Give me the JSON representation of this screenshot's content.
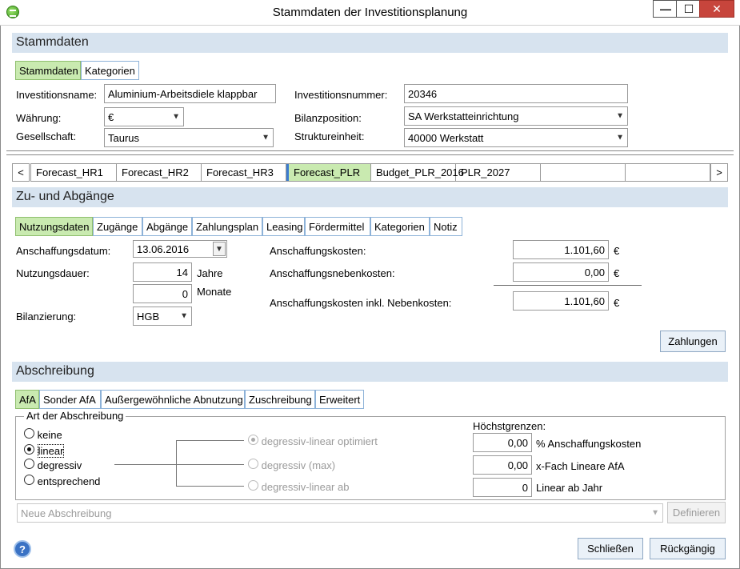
{
  "window": {
    "title": "Stammdaten der Investitionsplanung",
    "min_glyph": "—",
    "max_glyph": "☐",
    "close_glyph": "✕"
  },
  "stammdaten": {
    "header": "Stammdaten",
    "tabs": [
      "Stammdaten",
      "Kategorien"
    ],
    "investitionsname_label": "Investitionsname:",
    "investitionsname_value": "Aluminium-Arbeitsdiele klappbar",
    "waehrung_label": "Währung:",
    "waehrung_value": "€",
    "gesellschaft_label": "Gesellschaft:",
    "gesellschaft_value": "Taurus",
    "investitionsnummer_label": "Investitionsnummer:",
    "investitionsnummer_value": "20346",
    "bilanzposition_label": "Bilanzposition:",
    "bilanzposition_value": "SA Werkstatteinrichtung",
    "struktureinheit_label": "Struktureinheit:",
    "struktureinheit_value": "40000 Werkstatt"
  },
  "forecast": {
    "prev": "<",
    "next": ">",
    "tabs": [
      "Forecast_HR1",
      "Forecast_HR2",
      "Forecast_HR3",
      "Forecast_PLR",
      "Budget_PLR_2016",
      "PLR_2027",
      "",
      ""
    ]
  },
  "zugaenge": {
    "header": "Zu- und Abgänge",
    "tabs": [
      "Nutzungsdaten",
      "Zugänge",
      "Abgänge",
      "Zahlungsplan",
      "Leasing",
      "Fördermittel",
      "Kategorien",
      "Notiz"
    ],
    "anschaffungsdatum_label": "Anschaffungsdatum:",
    "anschaffungsdatum_value": "13.06.2016",
    "nutzungsdauer_label": "Nutzungsdauer:",
    "jahre_value": "14",
    "jahre_label": "Jahre",
    "monate_value": "0",
    "monate_label": "Monate",
    "bilanzierung_label": "Bilanzierung:",
    "bilanzierung_value": "HGB",
    "anschaffungskosten_label": "Anschaffungskosten:",
    "anschaffungskosten_value": "1.101,60",
    "nebenkosten_label": "Anschaffungsnebenkosten:",
    "nebenkosten_value": "0,00",
    "inkl_label": "Anschaffungskosten inkl. Nebenkosten:",
    "inkl_value": "1.101,60",
    "currency": "€",
    "zahlungen_button": "Zahlungen"
  },
  "abschreibung": {
    "header": "Abschreibung",
    "tabs": [
      "AfA",
      "Sonder AfA",
      "Außergewöhnliche Abnutzung",
      "Zuschreibung",
      "Erweitert"
    ],
    "group_label": "Art der Abschreibung",
    "options": [
      "keine",
      "linear",
      "degressiv",
      "entsprechend"
    ],
    "selected": "linear",
    "sub_options": [
      "degressiv-linear optimiert",
      "degressiv (max)",
      "degressiv-linear ab"
    ],
    "hoechst_label": "Höchstgrenzen:",
    "limits": [
      {
        "value": "0,00",
        "label": "% Anschaffungskosten"
      },
      {
        "value": "0,00",
        "label": "x-Fach Lineare AfA"
      },
      {
        "value": "0",
        "label": "Linear ab Jahr"
      }
    ],
    "neue_placeholder": "Neue Abschreibung",
    "definieren_button": "Definieren"
  },
  "footer": {
    "help_glyph": "?",
    "schliessen_button": "Schließen",
    "rueckgaengig_button": "Rückgängig"
  }
}
